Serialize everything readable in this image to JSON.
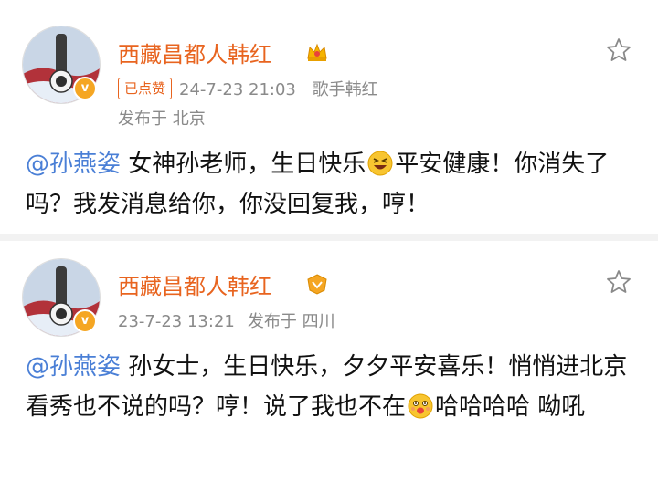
{
  "posts": [
    {
      "username": "西藏昌都人韩红",
      "liked_label": "已点赞",
      "timestamp": "24-7-23 21:03",
      "source": "歌手韩红",
      "location": "发布于 北京",
      "mention": "@孙燕姿",
      "text_part1": " 女神孙老师，生日快乐",
      "emoji": "grinning-squint-emoji",
      "text_part2": "平安健康！你消失了吗？我发消息给你，你没回复我，哼！"
    },
    {
      "username": "西藏昌都人韩红",
      "timestamp": "23-7-23 13:21",
      "location": "发布于 四川",
      "mention": "@孙燕姿",
      "text_part1": " 孙女士，生日快乐，夕夕平安喜乐！悄悄进北京看秀也不说的吗？哼！说了我也不在",
      "emoji": "tongue-face-emoji",
      "text_part2": "哈哈哈哈 呦吼"
    }
  ],
  "colors": {
    "username": "#e8641f",
    "mention": "#4a7fd6",
    "meta": "#8a8a8a",
    "badge": "#f5a623"
  }
}
